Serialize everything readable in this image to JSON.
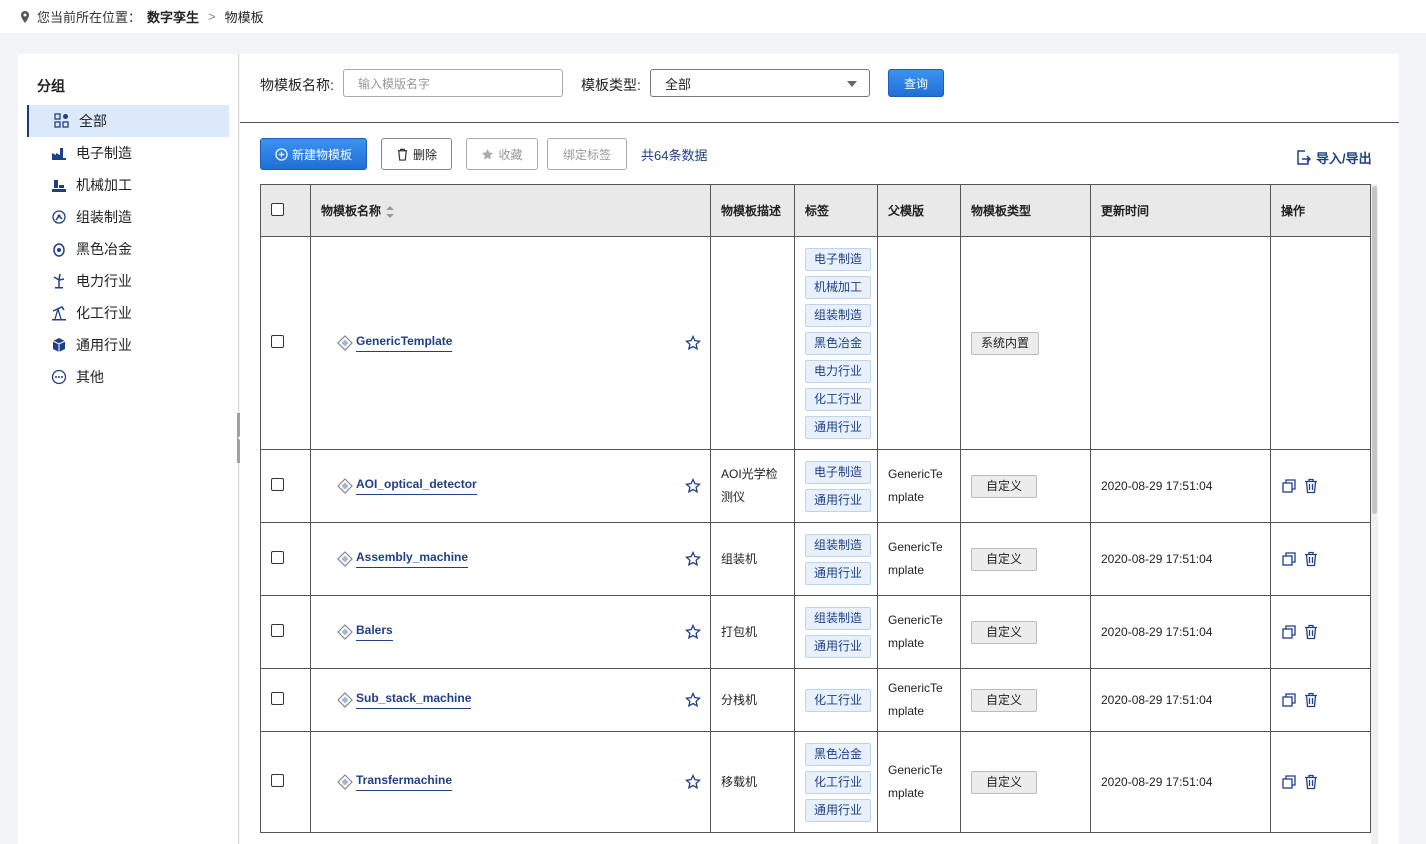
{
  "breadcrumb": {
    "prefix": "您当前所在位置：",
    "crumb1": "数字孪生",
    "crumb2": "物模板"
  },
  "sidebar": {
    "title": "分组",
    "items": [
      {
        "label": "全部",
        "icon": "grid-icon"
      },
      {
        "label": "电子制造",
        "icon": "factory-icon"
      },
      {
        "label": "机械加工",
        "icon": "machine-icon"
      },
      {
        "label": "组装制造",
        "icon": "robot-arm-icon"
      },
      {
        "label": "黑色冶金",
        "icon": "furnace-icon"
      },
      {
        "label": "电力行业",
        "icon": "wind-turbine-icon"
      },
      {
        "label": "化工行业",
        "icon": "oil-pump-icon"
      },
      {
        "label": "通用行业",
        "icon": "cube-icon"
      },
      {
        "label": "其他",
        "icon": "more-icon"
      }
    ]
  },
  "filter": {
    "name_label": "物模板名称:",
    "name_placeholder": "输入模版名字",
    "type_label": "模板类型:",
    "type_value": "全部",
    "query": "查询"
  },
  "toolbar": {
    "new": "新建物模板",
    "delete": "删除",
    "favorite": "收藏",
    "bind_tag": "绑定标签",
    "count": "共64条数据",
    "import_export": "导入/导出"
  },
  "table": {
    "headers": [
      "物模板名称",
      "物模板描述",
      "标签",
      "父模版",
      "物模板类型",
      "更新时间",
      "操作"
    ],
    "rows": [
      {
        "name": "GenericTemplate",
        "desc": "",
        "tags": [
          "电子制造",
          "机械加工",
          "组装制造",
          "黑色冶金",
          "电力行业",
          "化工行业",
          "通用行业"
        ],
        "parent": "",
        "type": "系统内置",
        "time": ""
      },
      {
        "name": "AOI_optical_detector",
        "desc": "AOI光学检测仪",
        "tags": [
          "电子制造",
          "通用行业"
        ],
        "parent": "GenericTemplate",
        "type": "自定义",
        "time": "2020-08-29 17:51:04"
      },
      {
        "name": "Assembly_machine",
        "desc": "组装机",
        "tags": [
          "组装制造",
          "通用行业"
        ],
        "parent": "GenericTemplate",
        "type": "自定义",
        "time": "2020-08-29 17:51:04"
      },
      {
        "name": "Balers",
        "desc": "打包机",
        "tags": [
          "组装制造",
          "通用行业"
        ],
        "parent": "GenericTemplate",
        "type": "自定义",
        "time": "2020-08-29 17:51:04"
      },
      {
        "name": "Sub_stack_machine",
        "desc": "分栈机",
        "tags": [
          "化工行业"
        ],
        "parent": "GenericTemplate",
        "type": "自定义",
        "time": "2020-08-29 17:51:04"
      },
      {
        "name": "Transfermachine",
        "desc": "移载机",
        "tags": [
          "黑色冶金",
          "化工行业",
          "通用行业"
        ],
        "parent": "GenericTemplate",
        "type": "自定义",
        "time": "2020-08-29 17:51:04"
      }
    ]
  }
}
